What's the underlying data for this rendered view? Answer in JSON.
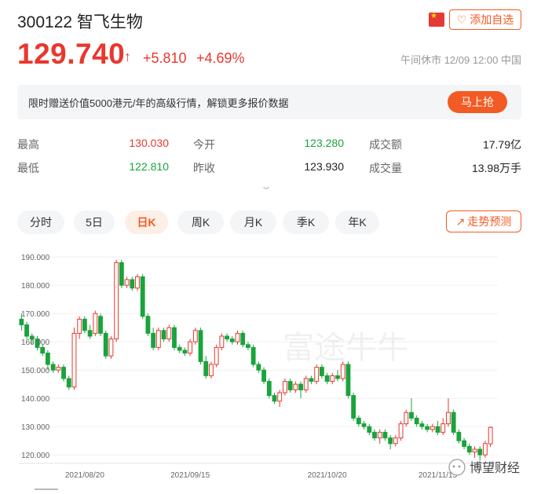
{
  "header": {
    "title": "300122 智飞生物",
    "fav_label": "添加自选",
    "flag_icon": "china-flag-icon"
  },
  "quote": {
    "price": "129.740",
    "arrow": "↑",
    "change": "+5.810",
    "change_pct": "+4.69%",
    "status": "午间休市 12/09 12:00 中国"
  },
  "promo": {
    "text": "限时赠送价值5000港元/年的高级行情，解锁更多报价数据",
    "button": "马上抢"
  },
  "stats": {
    "high_label": "最高",
    "high": "130.030",
    "open_label": "今开",
    "open": "123.280",
    "amount_label": "成交额",
    "amount": "17.79亿",
    "low_label": "最低",
    "low": "122.810",
    "prev_label": "昨收",
    "prev": "123.930",
    "volume_label": "成交量",
    "volume": "13.98万手"
  },
  "periods": [
    "分时",
    "5日",
    "日K",
    "周K",
    "月K",
    "季K",
    "年K"
  ],
  "active_period": "日K",
  "predict_label": "走势预测",
  "watermark": "富途牛牛",
  "wechat_label": "博望财经",
  "colors": {
    "up": "#e8382e",
    "down": "#1aa33d",
    "accent": "#f25b24"
  },
  "chart_data": {
    "type": "candlestick",
    "y_ticks": [
      "190.000",
      "180.000",
      "170.000",
      "160.000",
      "150.000",
      "140.000",
      "130.000",
      "120.000"
    ],
    "x_labels": [
      "2021/08/20",
      "2021/09/15",
      "2021/10/20",
      "2021/11/15"
    ],
    "ylim": [
      117,
      192
    ],
    "candles": [
      [
        168,
        166,
        170,
        164
      ],
      [
        166,
        162,
        167,
        161
      ],
      [
        162,
        161,
        163,
        159
      ],
      [
        161,
        158,
        162,
        157
      ],
      [
        158,
        156,
        159,
        155
      ],
      [
        156,
        152,
        157,
        150
      ],
      [
        152,
        150,
        153,
        149
      ],
      [
        150,
        151,
        152,
        149
      ],
      [
        151,
        147,
        152,
        146
      ],
      [
        147,
        144,
        148,
        143
      ],
      [
        144,
        163,
        165,
        143
      ],
      [
        163,
        168,
        169,
        161
      ],
      [
        168,
        164,
        169,
        163
      ],
      [
        164,
        162,
        166,
        161
      ],
      [
        163,
        170,
        171,
        162
      ],
      [
        169,
        163,
        170,
        162
      ],
      [
        163,
        155,
        164,
        154
      ],
      [
        155,
        161,
        162,
        154
      ],
      [
        161,
        188,
        189,
        160
      ],
      [
        188,
        180,
        189,
        179
      ],
      [
        180,
        182,
        183,
        179
      ],
      [
        182,
        179,
        183,
        178
      ],
      [
        179,
        183,
        184,
        178
      ],
      [
        183,
        169,
        184,
        168
      ],
      [
        169,
        163,
        170,
        162
      ],
      [
        163,
        158,
        165,
        157
      ],
      [
        158,
        164,
        165,
        157
      ],
      [
        164,
        161,
        165,
        160
      ],
      [
        161,
        165,
        166,
        160
      ],
      [
        165,
        158,
        166,
        157
      ],
      [
        158,
        157,
        159,
        156
      ],
      [
        157,
        156,
        158,
        155
      ],
      [
        156,
        160,
        161,
        155
      ],
      [
        160,
        164,
        165,
        159
      ],
      [
        164,
        153,
        165,
        152
      ],
      [
        153,
        148,
        155,
        147
      ],
      [
        148,
        152,
        153,
        147
      ],
      [
        152,
        158,
        159,
        151
      ],
      [
        158,
        162,
        163,
        157
      ],
      [
        162,
        161,
        163,
        160
      ],
      [
        161,
        160,
        162,
        159
      ],
      [
        160,
        163,
        164,
        159
      ],
      [
        163,
        159,
        164,
        158
      ],
      [
        159,
        158,
        160,
        157
      ],
      [
        158,
        152,
        159,
        151
      ],
      [
        152,
        150,
        153,
        149
      ],
      [
        150,
        146,
        151,
        145
      ],
      [
        146,
        141,
        147,
        140
      ],
      [
        141,
        139,
        142,
        138
      ],
      [
        139,
        142,
        143,
        137
      ],
      [
        142,
        146,
        147,
        141
      ],
      [
        146,
        143,
        147,
        142
      ],
      [
        143,
        145,
        146,
        142
      ],
      [
        145,
        143,
        146,
        140
      ],
      [
        143,
        147,
        148,
        142
      ],
      [
        147,
        146,
        148,
        145
      ],
      [
        146,
        151,
        152,
        145
      ],
      [
        151,
        148,
        152,
        147
      ],
      [
        148,
        146,
        149,
        145
      ],
      [
        146,
        148,
        149,
        145
      ],
      [
        148,
        147,
        150,
        146
      ],
      [
        147,
        152,
        153,
        146
      ],
      [
        152,
        141,
        153,
        140
      ],
      [
        141,
        133,
        142,
        132
      ],
      [
        133,
        131,
        134,
        130
      ],
      [
        131,
        130,
        132,
        129
      ],
      [
        130,
        128,
        131,
        127
      ],
      [
        128,
        126,
        129,
        125
      ],
      [
        126,
        128,
        129,
        124
      ],
      [
        128,
        126,
        129,
        125
      ],
      [
        126,
        124,
        127,
        122
      ],
      [
        124,
        126,
        127,
        123
      ],
      [
        126,
        131,
        132,
        125
      ],
      [
        131,
        135,
        136,
        130
      ],
      [
        135,
        133,
        140,
        132
      ],
      [
        133,
        131,
        134,
        130
      ],
      [
        131,
        130,
        132,
        129
      ],
      [
        130,
        129,
        131,
        128
      ],
      [
        129,
        130,
        131,
        128
      ],
      [
        130,
        128,
        132,
        127
      ],
      [
        128,
        131,
        133,
        127
      ],
      [
        131,
        135,
        140,
        130
      ],
      [
        135,
        128,
        136,
        127
      ],
      [
        128,
        125,
        129,
        124
      ],
      [
        125,
        123,
        126,
        122
      ],
      [
        123,
        121,
        124,
        120
      ],
      [
        121,
        122,
        123,
        119
      ],
      [
        122,
        120,
        123,
        118
      ],
      [
        120,
        124,
        125,
        119
      ],
      [
        123.93,
        129.74,
        130.03,
        122.81
      ]
    ]
  }
}
